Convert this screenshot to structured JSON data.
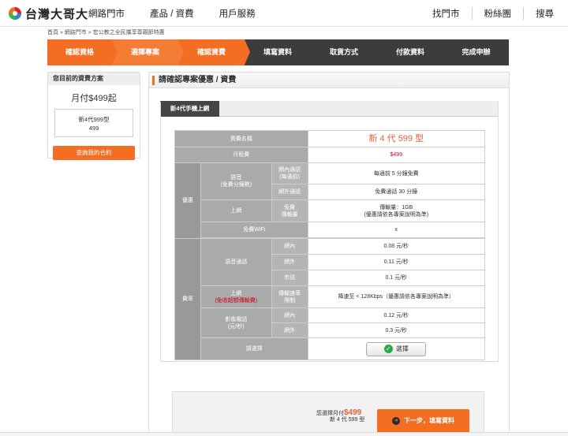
{
  "header": {
    "brand": "台灣大哥大",
    "nav": [
      "網路門市",
      "產品 / 資費",
      "用戶服務"
    ],
    "right_nav": [
      "找門市",
      "粉絲團",
      "搜尋"
    ]
  },
  "breadcrumb": "首頁 » 網路門市 » 宏公教之全民攜享尊親節特惠",
  "steps": [
    {
      "label": "確認資格",
      "active": true
    },
    {
      "label": "選擇專案",
      "active": true
    },
    {
      "label": "確認資費",
      "active": true
    },
    {
      "label": "填寫資料",
      "active": false
    },
    {
      "label": "取貨方式",
      "active": false
    },
    {
      "label": "付款資料",
      "active": false
    },
    {
      "label": "完成申辦",
      "active": false
    }
  ],
  "sidebar": {
    "heading": "您目前的資費方案",
    "price": "月付$499起",
    "plan_name": "新4代999型",
    "plan_value": "499",
    "button": "查詢我的合約"
  },
  "main": {
    "title": "請確認專案優惠 / 資費",
    "tab": "新4代手機上網"
  },
  "table": {
    "plan_name_label": "資費名稱",
    "plan_name_value": "新 4 代 599 型",
    "monthly_label": "月租費",
    "monthly_value": "$499",
    "discount_label": "優惠",
    "voice_label": "語音\n(免費分鐘數)",
    "onnet_label": "網內通話\n(每通前)",
    "onnet_value": "每通前 5 分鐘免費",
    "offnet_label": "網外通話",
    "offnet_value": "免費通話 30 分鐘",
    "data_label": "上網",
    "data_sub_label": "免費\n傳輸量",
    "data_value": "傳輸量：1GB\n(優惠請依各專案說明為準)",
    "wifi_label": "免費WiFi",
    "wifi_value": "x",
    "rate_label": "費率",
    "voice_call_label": "語音通話",
    "rate_onnet_label": "網內",
    "rate_onnet_value": "0.08 元/秒",
    "rate_offnet_label": "網外",
    "rate_offnet_value": "0.11 元/秒",
    "rate_local_label": "市話",
    "rate_local_value": "0.1 元/秒",
    "rate_data_label": "上網",
    "rate_data_note": "(免收超額傳輸費)",
    "rate_data_sub": "傳輸速率\n限制",
    "rate_data_value": "降速至 < 128Kbps（優惠請依各專案說明為準）",
    "video_label": "影像電話\n(元/秒)",
    "video_onnet_label": "網內",
    "video_onnet_value": "0.12 元/秒",
    "video_offnet_label": "網外",
    "video_offnet_value": "0.3 元/秒",
    "select_label": "請選擇",
    "select_button": "選擇"
  },
  "summary": {
    "prefix": "您選擇月付",
    "amount": "$499",
    "plan": "新 4 代 599 型",
    "next_button": "下一步，填寫資料"
  },
  "colors": {
    "accent": "#f36d22",
    "dark_bar": "#3c3c3c",
    "price_text": "#e8603a"
  }
}
